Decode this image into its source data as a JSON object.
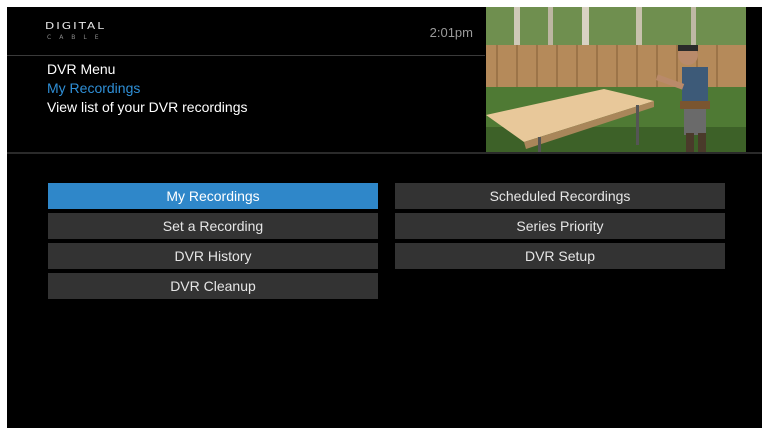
{
  "header": {
    "logo_main": "DIGITAL",
    "logo_sub": "CABLE",
    "time": "2:01pm",
    "menu_title": "DVR Menu",
    "current_item": "My Recordings",
    "description": "View list of your DVR recordings"
  },
  "menu": {
    "left": [
      {
        "label": "My Recordings",
        "selected": true
      },
      {
        "label": "Set a Recording",
        "selected": false
      },
      {
        "label": "DVR History",
        "selected": false
      },
      {
        "label": "DVR Cleanup",
        "selected": false
      }
    ],
    "right": [
      {
        "label": "Scheduled Recordings",
        "selected": false
      },
      {
        "label": "Series Priority",
        "selected": false
      },
      {
        "label": "DVR Setup",
        "selected": false
      }
    ]
  },
  "colors": {
    "background": "#000000",
    "accent": "#2f87c9",
    "button": "#333333",
    "highlight_text": "#2f8fd6"
  },
  "icons": {
    "preview": "live-tv-preview-image"
  }
}
